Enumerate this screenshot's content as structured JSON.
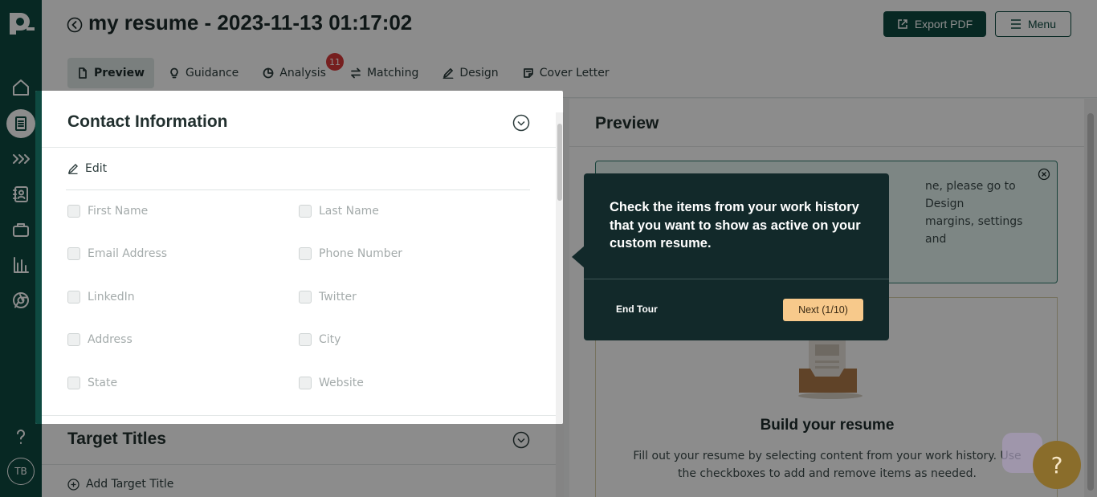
{
  "sidebar": {
    "avatar_initials": "TB",
    "icons": [
      "logo-icon",
      "home-icon",
      "resume-icon",
      "chevrons-icon",
      "contacts-icon",
      "briefcase-icon",
      "chart-icon",
      "chrome-icon",
      "help-icon"
    ]
  },
  "header": {
    "title": "my resume - 2023-11-13 01:17:02",
    "export_label": "Export PDF",
    "menu_label": "Menu",
    "tabs": [
      {
        "label": "Preview"
      },
      {
        "label": "Guidance"
      },
      {
        "label": "Analysis",
        "badge": "11"
      },
      {
        "label": "Matching"
      },
      {
        "label": "Design"
      },
      {
        "label": "Cover Letter"
      }
    ]
  },
  "contact": {
    "title": "Contact Information",
    "edit_label": "Edit",
    "fields": [
      "First Name",
      "Last Name",
      "Email Address",
      "Phone Number",
      "LinkedIn",
      "Twitter",
      "Address",
      "City",
      "State",
      "Website"
    ]
  },
  "target_titles": {
    "title": "Target Titles",
    "add_label": "Add Target Title"
  },
  "preview": {
    "title": "Preview",
    "info_line1": "ne, please go to Design",
    "info_line2": "margins, settings and",
    "build_title": "Build your resume",
    "build_desc": "Fill out your resume by selecting content from your work history. Use the checkboxes to add and remove items as needed."
  },
  "tour": {
    "text": "Check the items from your work history that you want to show as active on your custom resume.",
    "end_label": "End Tour",
    "next_label": "Next (1/10)"
  },
  "help_label": "?"
}
